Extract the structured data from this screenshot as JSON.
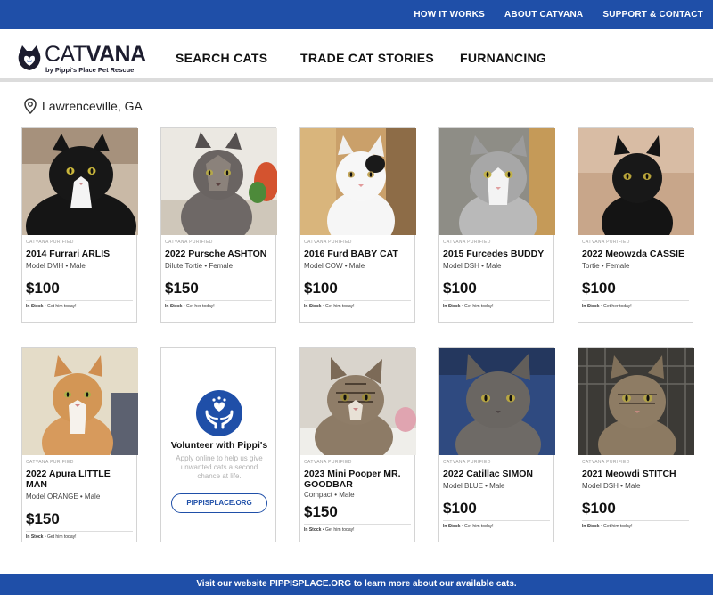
{
  "topbar": {
    "links": [
      "HOW IT WORKS",
      "ABOUT CATVANA",
      "SUPPORT & CONTACT"
    ]
  },
  "header": {
    "logo_bold": "VANA",
    "logo_thin": "CAT",
    "logo_sub": "by Pippi's Place Pet Rescue",
    "nav": [
      "SEARCH CATS",
      "TRADE CAT STORIES",
      "FURNANCING"
    ]
  },
  "location": "Lawrenceville, GA",
  "cards": [
    {
      "tag": "CATVANA PURIFIED",
      "name": "2014 Furrari ARLIS",
      "model": "Model DMH • Male",
      "price": "$100",
      "stock": "In Stock",
      "stock_note": " • Get him today!"
    },
    {
      "tag": "CATVANA PURIFIED",
      "name": "2022 Pursche ASHTON",
      "model": "Dilute Tortie • Female",
      "price": "$150",
      "stock": "In Stock",
      "stock_note": " • Get her today!"
    },
    {
      "tag": "CATVANA PURIFIED",
      "name": "2016 Furd BABY CAT",
      "model": "Model COW • Male",
      "price": "$100",
      "stock": "In Stock",
      "stock_note": " • Get him today!"
    },
    {
      "tag": "CATVANA PURIFIED",
      "name": "2015 Furcedes BUDDY",
      "model": "Model DSH • Male",
      "price": "$100",
      "stock": "In Stock",
      "stock_note": " • Get him today!"
    },
    {
      "tag": "CATVANA PURIFIED",
      "name": "2022 Meowzda CASSIE",
      "model": "Tortie • Female",
      "price": "$100",
      "stock": "In Stock",
      "stock_note": " • Get her today!"
    },
    {
      "tag": "CATVANA PURIFIED",
      "name": "2022 Apura LITTLE MAN",
      "model": "Model ORANGE • Male",
      "price": "$150",
      "stock": "In Stock",
      "stock_note": " • Get him today!"
    },
    {
      "tag": "CATVANA PURIFIED",
      "name": "2023 Mini Pooper MR. GOODBAR",
      "model": "Compact • Male",
      "price": "$150",
      "stock": "In Stock",
      "stock_note": " • Get him today!"
    },
    {
      "tag": "CATVANA PURIFIED",
      "name": "2022 Catillac SIMON",
      "model": "Model BLUE • Male",
      "price": "$100",
      "stock": "In Stock",
      "stock_note": " • Get him today!"
    },
    {
      "tag": "CATVANA PURIFIED",
      "name": "2021 Meowdi STITCH",
      "model": "Model DSH • Male",
      "price": "$100",
      "stock": "In Stock",
      "stock_note": " • Get him today!"
    }
  ],
  "promo": {
    "title": "Volunteer with Pippi's",
    "desc": "Apply online to help us give unwanted cats a second chance at life.",
    "button": "PIPPISPLACE.ORG"
  },
  "footer": "Visit our website PIPPISPLACE.ORG to learn more about our available cats.",
  "colors": {
    "brand_blue": "#1f4fa8"
  },
  "icons": [
    "location-pin-icon",
    "heart-hands-icon",
    "catvana-logo-icon"
  ]
}
